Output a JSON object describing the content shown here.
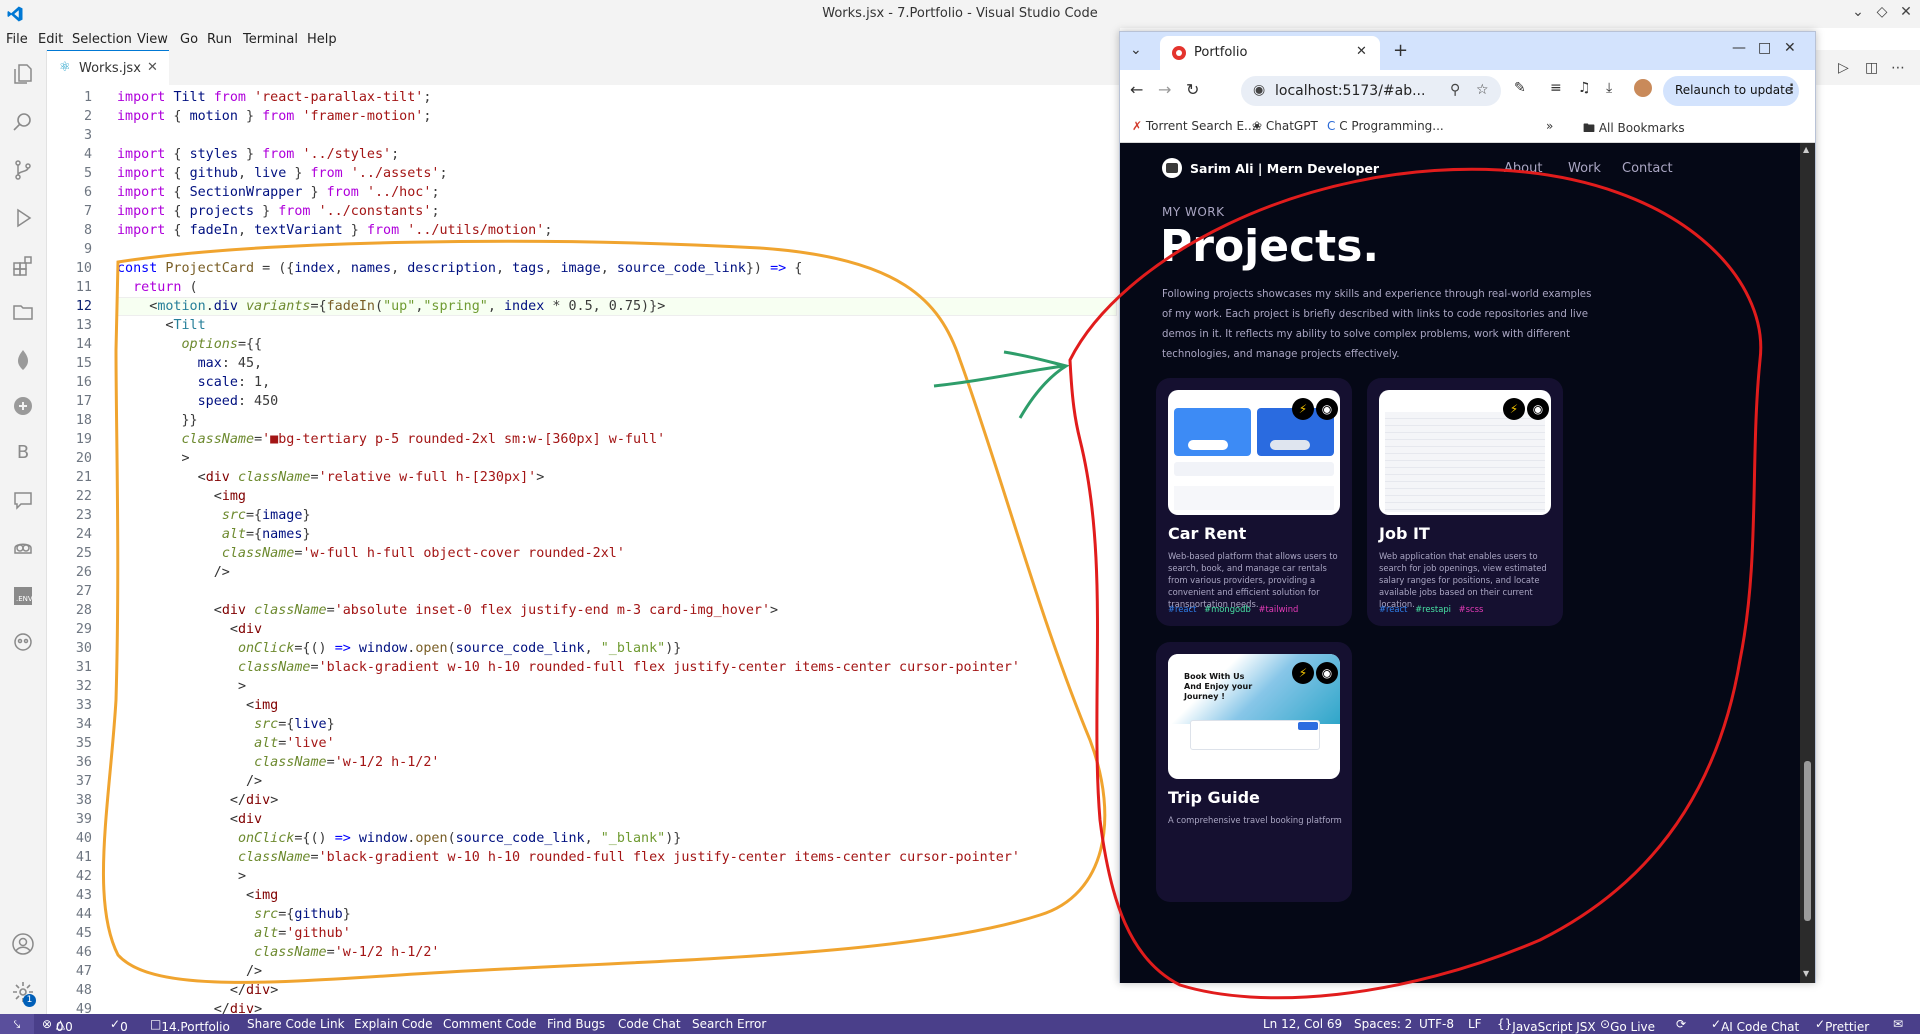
{
  "window": {
    "title": "Works.jsx - 7.Portfolio - Visual Studio Code"
  },
  "menu": [
    "File",
    "Edit",
    "Selection",
    "View",
    "Go",
    "Run",
    "Terminal",
    "Help"
  ],
  "activity_icons": [
    "explorer-icon",
    "search-icon",
    "source-control-icon",
    "run-debug-icon",
    "extensions-icon",
    "folder-icon",
    "mongodb-icon",
    "remote-icon",
    "bootstrap-icon",
    "chat-icon",
    "copilot-icon",
    "env-icon",
    "alien-icon"
  ],
  "bottom_icons": [
    "account-icon",
    "settings-icon"
  ],
  "settings_badge": "1",
  "editor_tab": {
    "name": "Works.jsx",
    "icon": "react-icon"
  },
  "code": [
    {
      "n": "1",
      "html": "<span class='kc'>import</span> <span class='v'>Tilt</span> <span class='kc'>from</span> <span class='s'>'react-parallax-tilt'</span>;"
    },
    {
      "n": "2",
      "html": "<span class='kc'>import</span> { <span class='v'>motion</span> } <span class='kc'>from</span> <span class='s'>'framer-motion'</span>;"
    },
    {
      "n": "3",
      "html": ""
    },
    {
      "n": "4",
      "html": "<span class='kc'>import</span> { <span class='v'>styles</span> } <span class='kc'>from</span> <span class='s'>'../styles'</span>;"
    },
    {
      "n": "5",
      "html": "<span class='kc'>import</span> { <span class='v'>github</span>, <span class='v'>live</span> } <span class='kc'>from</span> <span class='s'>'../assets'</span>;"
    },
    {
      "n": "6",
      "html": "<span class='kc'>import</span> { <span class='v'>SectionWrapper</span> } <span class='kc'>from</span> <span class='s'>'../hoc'</span>;"
    },
    {
      "n": "7",
      "html": "<span class='kc'>import</span> { <span class='v'>projects</span> } <span class='kc'>from</span> <span class='s'>'../constants'</span>;"
    },
    {
      "n": "8",
      "html": "<span class='kc'>import</span> { <span class='v'>fadeIn</span>, <span class='v'>textVariant</span> } <span class='kc'>from</span> <span class='s'>'../utils/motion'</span>;"
    },
    {
      "n": "9",
      "html": ""
    },
    {
      "n": "10",
      "html": "<span class='k'>const</span> <span class='f'>ProjectCard</span> = ({<span class='v'>index</span>, <span class='v'>names</span>, <span class='v'>description</span>, <span class='v'>tags</span>, <span class='v'>image</span>, <span class='v'>source_code_link</span>}) <span class='k'>=&gt;</span> {"
    },
    {
      "n": "11",
      "html": "  <span class='kc'>return</span> ("
    },
    {
      "n": "12",
      "html": "    <span class='p'>&lt;</span><span class='t'>motion</span>.<span class='v'>div</span> <span class='gr i'>variants</span>={<span class='f'>fadeIn</span>(<span class='str'>\"up\"</span>,<span class='str'>\"spring\"</span>, <span class='v'>index</span> * 0.5, 0.75)}<span class='p'>&gt;</span>"
    },
    {
      "n": "13",
      "html": "      <span class='p'>&lt;</span><span class='t'>Tilt</span>"
    },
    {
      "n": "14",
      "html": "        <span class='gr i'>options</span>={{"
    },
    {
      "n": "15",
      "html": "          <span class='v'>max</span>: 45,"
    },
    {
      "n": "16",
      "html": "          <span class='v'>scale</span>: 1,"
    },
    {
      "n": "17",
      "html": "          <span class='v'>speed</span>: 450"
    },
    {
      "n": "18",
      "html": "        }}"
    },
    {
      "n": "19",
      "html": "        <span class='gr i'>className</span>=<span class='s'>'&#9632;bg-tertiary p-5 rounded-2xl sm:w-[360px] w-full'</span>"
    },
    {
      "n": "20",
      "html": "        <span class='p'>&gt;</span>"
    },
    {
      "n": "21",
      "html": "          <span class='p'>&lt;</span><span class='tag'>div</span> <span class='gr i'>className</span>=<span class='s'>'relative w-full h-[230px]'</span><span class='p'>&gt;</span>"
    },
    {
      "n": "22",
      "html": "            <span class='p'>&lt;</span><span class='tag'>img</span>"
    },
    {
      "n": "23",
      "html": "             <span class='gr i'>src</span>={<span class='v'>image</span>}"
    },
    {
      "n": "24",
      "html": "             <span class='gr i'>alt</span>={<span class='v'>names</span>}"
    },
    {
      "n": "25",
      "html": "             <span class='gr i'>className</span>=<span class='s'>'w-full h-full object-cover rounded-2xl'</span>"
    },
    {
      "n": "26",
      "html": "            <span class='p'>/&gt;</span>"
    },
    {
      "n": "27",
      "html": ""
    },
    {
      "n": "28",
      "html": "            <span class='p'>&lt;</span><span class='tag'>div</span> <span class='gr i'>className</span>=<span class='s'>'absolute inset-0 flex justify-end m-3 card-img_hover'</span><span class='p'>&gt;</span>"
    },
    {
      "n": "29",
      "html": "              <span class='p'>&lt;</span><span class='tag'>div</span>"
    },
    {
      "n": "30",
      "html": "               <span class='gr i'>onClick</span>={() <span class='k'>=&gt;</span> <span class='v'>window</span>.<span class='f'>open</span>(<span class='v'>source_code_link</span>, <span class='str'>\"_blank\"</span>)}"
    },
    {
      "n": "31",
      "html": "               <span class='gr i'>className</span>=<span class='s'>'black-gradient w-10 h-10 rounded-full flex justify-center items-center cursor-pointer'</span>"
    },
    {
      "n": "32",
      "html": "               <span class='p'>&gt;</span>"
    },
    {
      "n": "33",
      "html": "                <span class='p'>&lt;</span><span class='tag'>img</span>"
    },
    {
      "n": "34",
      "html": "                 <span class='gr i'>src</span>={<span class='v'>live</span>}"
    },
    {
      "n": "35",
      "html": "                 <span class='gr i'>alt</span>=<span class='s'>'live'</span>"
    },
    {
      "n": "36",
      "html": "                 <span class='gr i'>className</span>=<span class='s'>'w-1/2 h-1/2'</span>"
    },
    {
      "n": "37",
      "html": "                <span class='p'>/&gt;</span>"
    },
    {
      "n": "38",
      "html": "              <span class='p'>&lt;/</span><span class='tag'>div</span><span class='p'>&gt;</span>"
    },
    {
      "n": "39",
      "html": "              <span class='p'>&lt;</span><span class='tag'>div</span>"
    },
    {
      "n": "40",
      "html": "               <span class='gr i'>onClick</span>={() <span class='k'>=&gt;</span> <span class='v'>window</span>.<span class='f'>open</span>(<span class='v'>source_code_link</span>, <span class='str'>\"_blank\"</span>)}"
    },
    {
      "n": "41",
      "html": "               <span class='gr i'>className</span>=<span class='s'>'black-gradient w-10 h-10 rounded-full flex justify-center items-center cursor-pointer'</span>"
    },
    {
      "n": "42",
      "html": "               <span class='p'>&gt;</span>"
    },
    {
      "n": "43",
      "html": "                <span class='p'>&lt;</span><span class='tag'>img</span>"
    },
    {
      "n": "44",
      "html": "                 <span class='gr i'>src</span>={<span class='v'>github</span>}"
    },
    {
      "n": "45",
      "html": "                 <span class='gr i'>alt</span>=<span class='s'>'github'</span>"
    },
    {
      "n": "46",
      "html": "                 <span class='gr i'>className</span>=<span class='s'>'w-1/2 h-1/2'</span>"
    },
    {
      "n": "47",
      "html": "                <span class='p'>/&gt;</span>"
    },
    {
      "n": "48",
      "html": "              <span class='p'>&lt;/</span><span class='tag'>div</span><span class='p'>&gt;</span>"
    },
    {
      "n": "49",
      "html": "            <span class='p'>&lt;/</span><span class='tag'>div</span><span class='p'>&gt;</span>"
    }
  ],
  "current_line": "12",
  "status": {
    "errors": "0",
    "warnings": "0",
    "ports": "0",
    "folder": "14.Portfolio",
    "actions": [
      "Share Code Link",
      "Explain Code",
      "Comment Code",
      "Find Bugs",
      "Code Chat",
      "Search Error"
    ],
    "position": "Ln 12, Col 69",
    "spaces": "Spaces: 2",
    "encoding": "UTF-8",
    "eol": "LF",
    "language": "JavaScript JSX",
    "golive": "Go Live",
    "aichat": "AI Code Chat",
    "prettier": "Prettier"
  },
  "browser": {
    "tab_title": "Portfolio",
    "url": "localhost:5173/#ab...",
    "relaunch": "Relaunch to update",
    "bookmarks": [
      "Torrent Search E...",
      "ChatGPT",
      "C Programming..."
    ],
    "all_bookmarks": "All Bookmarks"
  },
  "site": {
    "brand": "Sarim Ali | Mern Developer",
    "nav": [
      "About",
      "Work",
      "Contact"
    ],
    "subtitle": "MY WORK",
    "title": "Projects.",
    "description": "Following projects showcases my skills and experience through real-world examples of my work. Each project is briefly described with links to code repositories and live demos in it. It reflects my ability to solve complex problems, work with different technologies, and manage projects effectively.",
    "projects": [
      {
        "name": "Car Rent",
        "description": "Web-based platform that allows users to search, book, and manage car rentals from various providers, providing a convenient and efficient solution for transportation needs.",
        "tags": [
          "#react",
          "#mongodb",
          "#tailwind"
        ]
      },
      {
        "name": "Job IT",
        "description": "Web application that enables users to search for job openings, view estimated salary ranges for positions, and locate available jobs based on their current location.",
        "tags": [
          "#react",
          "#restapi",
          "#scss"
        ]
      },
      {
        "name": "Trip Guide",
        "description": "A comprehensive travel booking platform",
        "tags": []
      }
    ],
    "tag_colors": [
      "#2f80ed",
      "#47e2a4",
      "#e53bb8"
    ],
    "hero_text": "Book With Us And Enjoy your Journey !"
  }
}
